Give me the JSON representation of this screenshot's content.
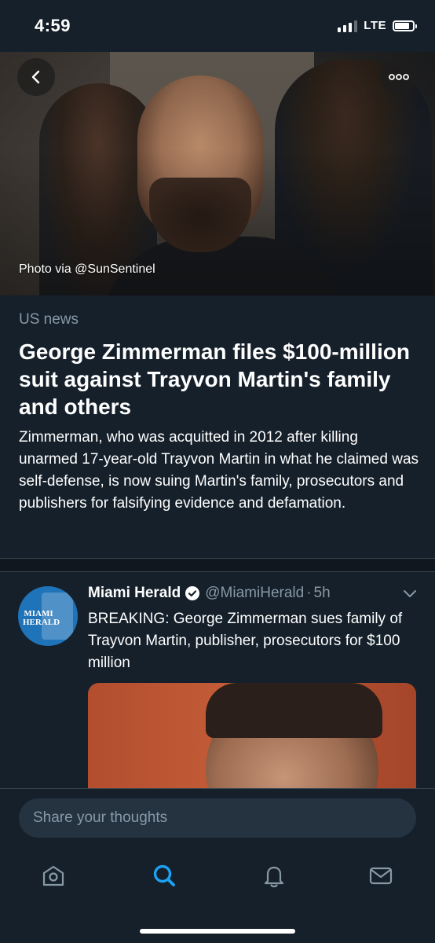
{
  "status_bar": {
    "time": "4:59",
    "network": "LTE",
    "signal_bars": 3,
    "battery_level": 0.8
  },
  "hero": {
    "photo_credit": "Photo via @SunSentinel",
    "back_icon": "chevron-left-icon",
    "more_icon": "more-horizontal-icon"
  },
  "article": {
    "category": "US news",
    "headline": "George Zimmerman files $100-million suit against Trayvon Martin's family and others",
    "summary": "Zimmerman, who was acquitted in 2012 after killing unarmed 17-year-old Trayvon Martin in what he claimed was self-defense, is now suing Martin's family, prosecutors and publishers for falsifying evidence and defamation."
  },
  "tweet": {
    "author": "Miami Herald",
    "verified": true,
    "handle": "@MiamiHerald",
    "separator": "·",
    "time": "5h",
    "avatar_text": "MIAMI HERALD",
    "text": "BREAKING: George Zimmerman sues family of Trayvon Martin, publisher, prosecutors for $100 million"
  },
  "composer": {
    "placeholder": "Share your thoughts"
  },
  "nav": {
    "items": [
      "home-icon",
      "search-icon",
      "notifications-icon",
      "messages-icon"
    ],
    "active": "search-icon"
  },
  "colors": {
    "background": "#15202b",
    "accent": "#1da1f2",
    "secondary_text": "#8899a6",
    "input_bg": "#253341"
  }
}
